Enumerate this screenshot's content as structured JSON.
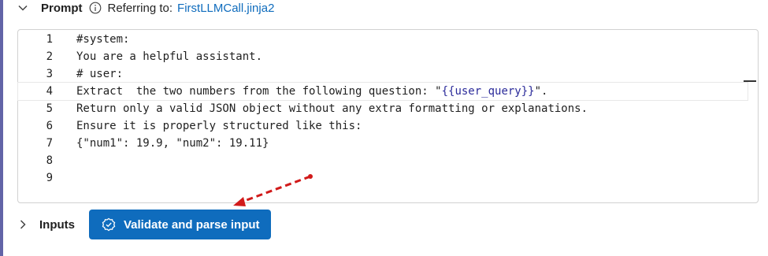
{
  "prompt": {
    "title": "Prompt",
    "referring_label": "Referring to:",
    "file_link": "FirstLLMCall.jinja2"
  },
  "editor": {
    "lines": [
      {
        "num": "1",
        "text": "#system:"
      },
      {
        "num": "2",
        "text": "You are a helpful assistant."
      },
      {
        "num": "3",
        "text": "# user:"
      },
      {
        "num": "4",
        "text_before": "Extract  the two numbers from the following question: \"",
        "template_var": "{{user_query}}",
        "text_after": "\"."
      },
      {
        "num": "5",
        "text": "Return only a valid JSON object without any extra formatting or explanations."
      },
      {
        "num": "6",
        "text": "Ensure it is properly structured like this:"
      },
      {
        "num": "7",
        "text": "{\"num1\": 19.9, \"num2\": 19.11}"
      },
      {
        "num": "8",
        "text": ""
      },
      {
        "num": "9",
        "text": ""
      }
    ]
  },
  "inputs": {
    "label": "Inputs",
    "validate_button": "Validate and parse input"
  },
  "colors": {
    "accent": "#0f6cbd",
    "annotation_arrow": "#d11a1a",
    "left_bar": "#6264a7"
  }
}
